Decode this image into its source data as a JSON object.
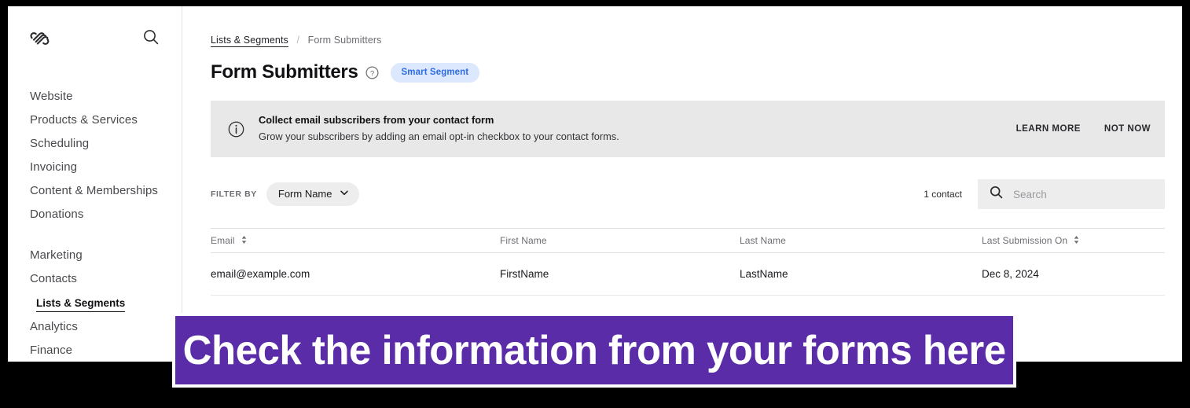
{
  "sidebar": {
    "logo_name": "squarespace-logo",
    "search_icon": "search-icon",
    "items": [
      {
        "label": "Website",
        "sub": false,
        "gap": false
      },
      {
        "label": "Products & Services",
        "sub": false,
        "gap": false
      },
      {
        "label": "Scheduling",
        "sub": false,
        "gap": false
      },
      {
        "label": "Invoicing",
        "sub": false,
        "gap": false
      },
      {
        "label": "Content & Memberships",
        "sub": false,
        "gap": false
      },
      {
        "label": "Donations",
        "sub": false,
        "gap": false
      },
      {
        "label": "Marketing",
        "sub": false,
        "gap": true
      },
      {
        "label": "Contacts",
        "sub": false,
        "gap": false
      },
      {
        "label": "Lists & Segments",
        "sub": true,
        "gap": false
      },
      {
        "label": "Analytics",
        "sub": false,
        "gap": false
      },
      {
        "label": "Finance",
        "sub": false,
        "gap": false
      }
    ]
  },
  "breadcrumb": {
    "parent": "Lists & Segments",
    "separator": "/",
    "current": "Form Submitters"
  },
  "header": {
    "title": "Form Submitters",
    "help_icon": "question-mark-circle-icon",
    "badge": "Smart Segment",
    "badge_bg": "#dce8fd",
    "badge_color": "#2e6ce0"
  },
  "banner": {
    "icon": "info-circle-icon",
    "title": "Collect email subscribers from your contact form",
    "subtitle": "Grow your subscribers by adding an email opt-in checkbox to your contact forms.",
    "learn_more": "LEARN MORE",
    "not_now": "NOT NOW",
    "background": "#e8e8e8"
  },
  "filters": {
    "label": "FILTER BY",
    "chip": "Form Name",
    "chevron_icon": "chevron-down-icon"
  },
  "search": {
    "count": "1 contact",
    "placeholder": "Search",
    "value": "",
    "icon": "search-icon"
  },
  "table": {
    "columns": [
      {
        "label": "Email",
        "sortable": true
      },
      {
        "label": "First Name",
        "sortable": false
      },
      {
        "label": "Last Name",
        "sortable": false
      },
      {
        "label": "Last Submission On",
        "sortable": true
      }
    ],
    "rows": [
      {
        "email": "email@example.com",
        "first_name": "FirstName",
        "last_name": "LastName",
        "last_submission_on": "Dec 8, 2024"
      }
    ]
  },
  "overlay": {
    "text": "Check the information from your forms here",
    "background": "#5a2ca8",
    "text_color": "#ffffff"
  }
}
